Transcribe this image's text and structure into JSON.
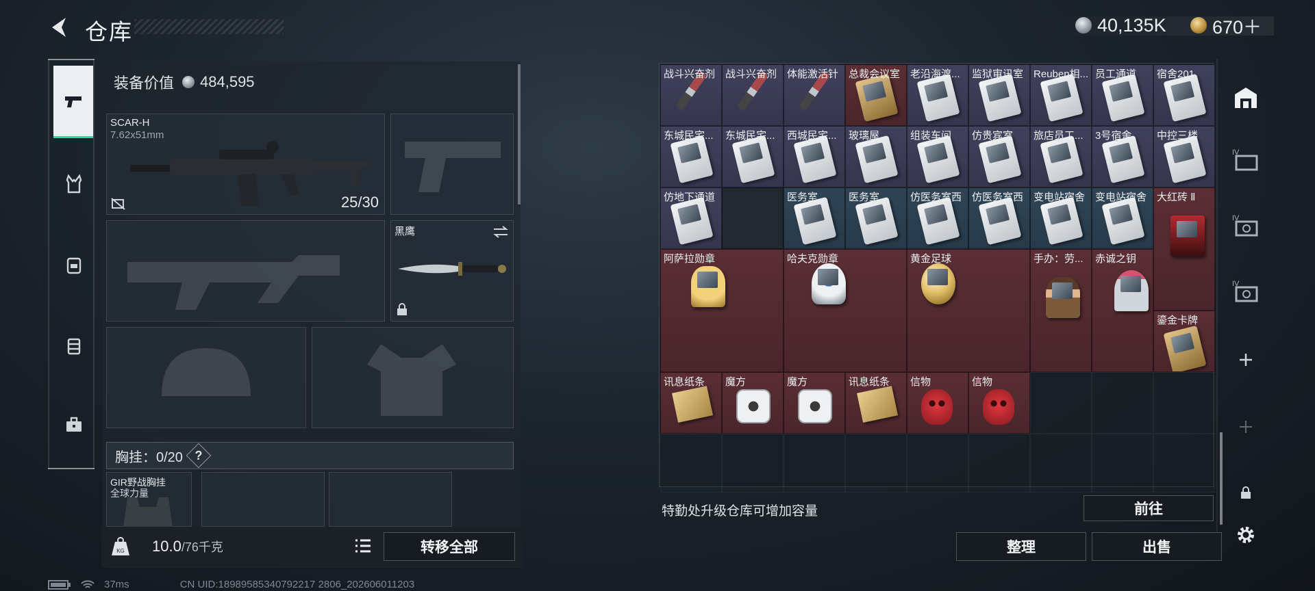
{
  "header": {
    "title": "仓库",
    "currency_silver": "40,135K",
    "currency_gold": "670＋"
  },
  "equipment": {
    "value_label": "装备价值",
    "value": "484,595",
    "primary": {
      "name": "SCAR-H",
      "caliber": "7.62x51mm",
      "ammo": "25/30"
    },
    "melee": {
      "name": "黑鹰"
    },
    "rig": {
      "label": "胸挂：0/20",
      "help": "?",
      "item_name": "GIR野战胸挂",
      "item_sub": "全球力量"
    },
    "weight": {
      "value": "10.0",
      "max": "/76千克"
    },
    "transfer_all": "转移全部"
  },
  "storage": {
    "rows": [
      [
        "战斗兴奋剂",
        "战斗兴奋剂",
        "体能激活针",
        "总裁会议室",
        "老沿海渡...",
        "监狱审讯室",
        "Reuben相...",
        "员工通道",
        "宿舍201"
      ],
      [
        "东城民宅...",
        "东城民宅...",
        "西城民宅...",
        "玻璃屋",
        "组装车间",
        "仿贵宾室",
        "旅店员工...",
        "3号宿舍",
        "中控三楼"
      ],
      [
        "仿地下通道",
        "",
        "医务室",
        "医务室",
        "仿医务室西",
        "仿医务室西",
        "变电站宿舍",
        "变电站宿舍",
        "大红砖 Ⅱ"
      ],
      [
        "阿萨拉勋章",
        "哈夫克勋章",
        "黄金足球",
        "手办：劳...",
        "赤诚之钥",
        "鎏金卡牌"
      ],
      [
        "讯息纸条",
        "魔方",
        "魔方",
        "讯息纸条",
        "信物",
        "信物"
      ]
    ],
    "hint": "特勤处升级仓库可增加容量",
    "goto": "前往",
    "sort": "整理",
    "sell": "出售"
  },
  "status": {
    "ping": "37ms",
    "uid": "CN UID:18989585340792217 2806_202606011203"
  }
}
